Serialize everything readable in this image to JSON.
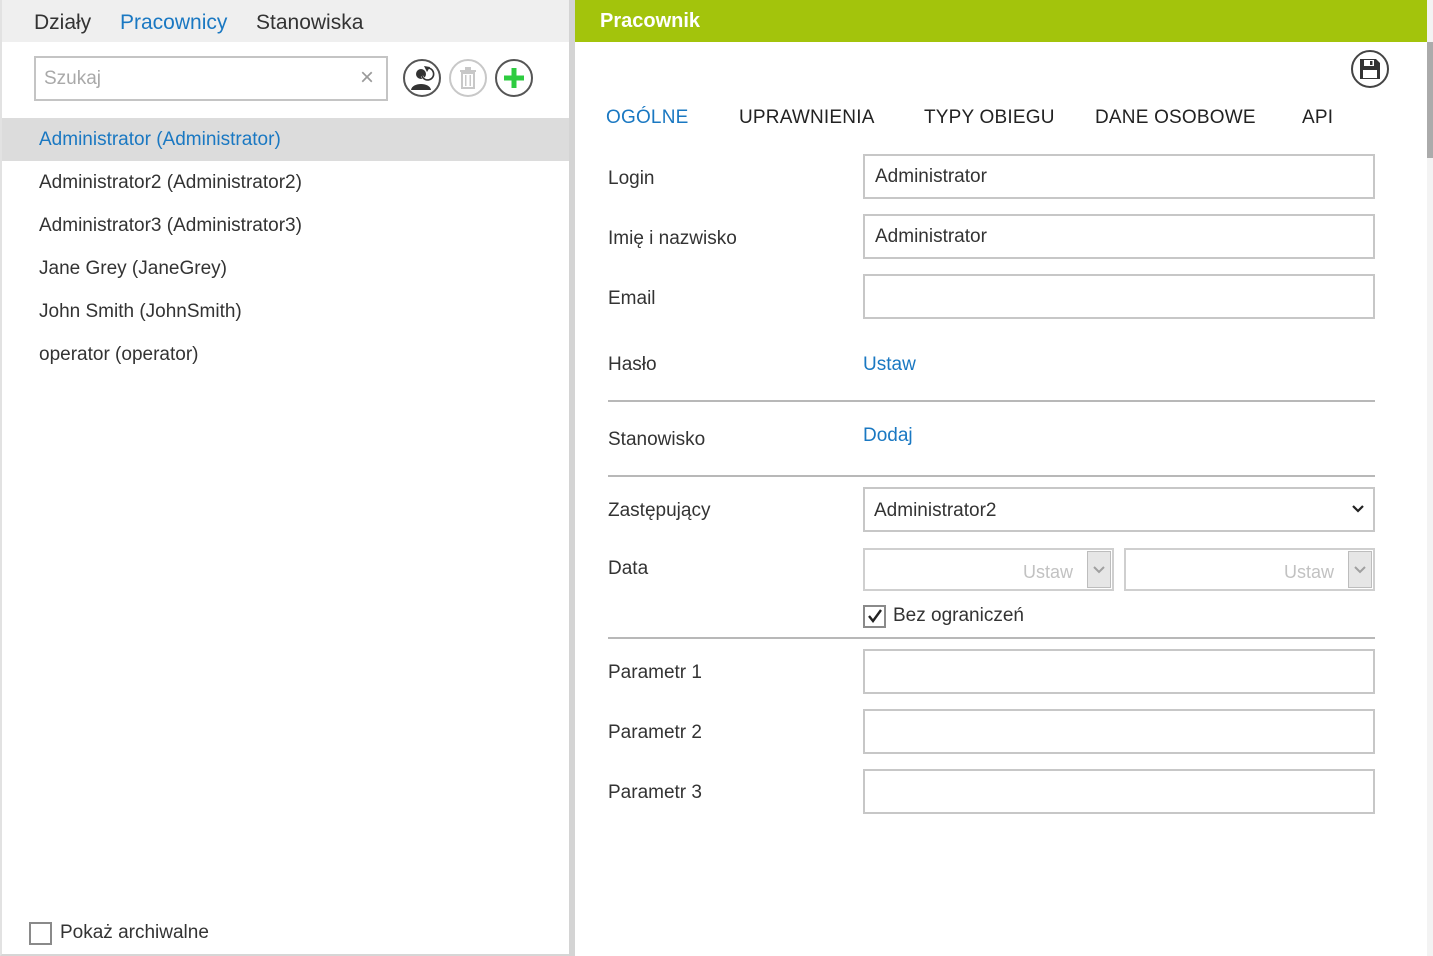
{
  "left": {
    "tabs": [
      "Działy",
      "Pracownicy",
      "Stanowiska"
    ],
    "active_tab": "Pracownicy",
    "search_placeholder": "Szukaj",
    "search_value": "",
    "users": [
      "Administrator (Administrator)",
      "Administrator2 (Administrator2)",
      "Administrator3 (Administrator3)",
      "Jane Grey (JaneGrey)",
      "John Smith (JohnSmith)",
      "operator (operator)"
    ],
    "selected_user": "Administrator (Administrator)",
    "show_archived_label": "Pokaż archiwalne",
    "show_archived_checked": false
  },
  "right": {
    "title": "Pracownik",
    "tabs": [
      "OGÓLNE",
      "UPRAWNIENIA",
      "TYPY OBIEGU",
      "DANE OSOBOWE",
      "API"
    ],
    "active_tab": "OGÓLNE",
    "form": {
      "login_label": "Login",
      "login_value": "Administrator",
      "name_label": "Imię i nazwisko",
      "name_value": "Administrator",
      "email_label": "Email",
      "email_value": "",
      "password_label": "Hasło",
      "password_link": "Ustaw",
      "position_label": "Stanowisko",
      "position_link": "Dodaj",
      "deputy_label": "Zastępujący",
      "deputy_value": "Administrator2",
      "date_label": "Data",
      "date_from_placeholder": "Ustaw",
      "date_to_placeholder": "Ustaw",
      "no_limit_label": "Bez ograniczeń",
      "no_limit_checked": true,
      "param1_label": "Parametr 1",
      "param1_value": "",
      "param2_label": "Parametr 2",
      "param2_value": "",
      "param3_label": "Parametr 3",
      "param3_value": ""
    }
  },
  "icons": {
    "refresh_user": "user-refresh-icon",
    "delete": "trash-icon",
    "add": "plus-icon",
    "save": "floppy-disk-icon",
    "clear": "close-icon",
    "dropdown": "chevron-down-icon",
    "check": "checkmark-icon"
  },
  "colors": {
    "accent_blue": "#1a78c2",
    "header_green": "#a3c40c",
    "add_green": "#2ecc40",
    "selected_bg": "#dcdcdc"
  }
}
